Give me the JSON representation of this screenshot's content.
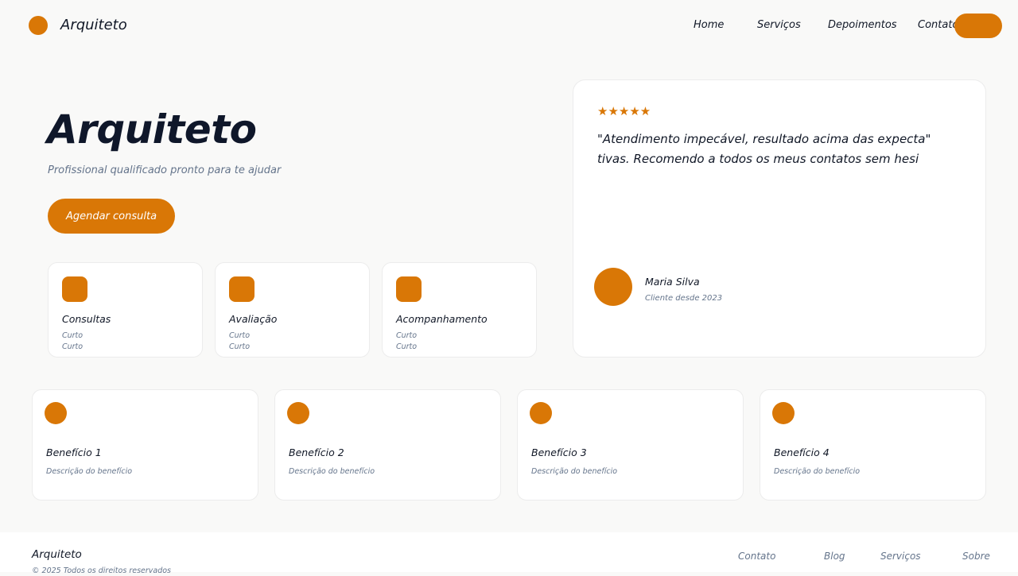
{
  "colors": {
    "accent": "#d97706",
    "heading": "#0f172a",
    "muted": "#64748b",
    "background": "#f9f9f8",
    "card": "#ffffff"
  },
  "header": {
    "brand": "Arquiteto",
    "logo_icon": "circle-logo-icon",
    "nav": [
      "Home",
      "Serviços",
      "Depoimentos",
      "Contato"
    ],
    "cta_label": ""
  },
  "hero": {
    "title": "Arquiteto",
    "subtitle": "Profissional qualificado pronto para te ajudar",
    "button_label": "Agendar consulta"
  },
  "services": [
    {
      "title": "Consultas",
      "line1": "Curto",
      "line2": "Curto",
      "icon": "service-square-icon"
    },
    {
      "title": "Avaliação",
      "line1": "Curto",
      "line2": "Curto",
      "icon": "service-square-icon"
    },
    {
      "title": "Acompanhamento",
      "line1": "Curto",
      "line2": "Curto",
      "icon": "service-square-icon"
    }
  ],
  "testimonial": {
    "rating": 5,
    "stars": "★★★★★",
    "quote": "\"Atendimento impecável, resultado acima das expecta\" tivas. Recomendo a todos os meus contatos sem hesi",
    "author": "Maria Silva",
    "since": "Cliente desde 2023"
  },
  "benefits": [
    {
      "title": "Benefício 1",
      "description": "Descrição do benefício"
    },
    {
      "title": "Benefício 2",
      "description": "Descrição do benefício"
    },
    {
      "title": "Benefício 3",
      "description": "Descrição do benefício"
    },
    {
      "title": "Benefício 4",
      "description": "Descrição do benefício"
    }
  ],
  "footer": {
    "brand": "Arquiteto",
    "copyright": "© 2025 Todos os direitos reservados",
    "links": [
      "Contato",
      "Blog",
      "Serviços",
      "Sobre"
    ]
  }
}
